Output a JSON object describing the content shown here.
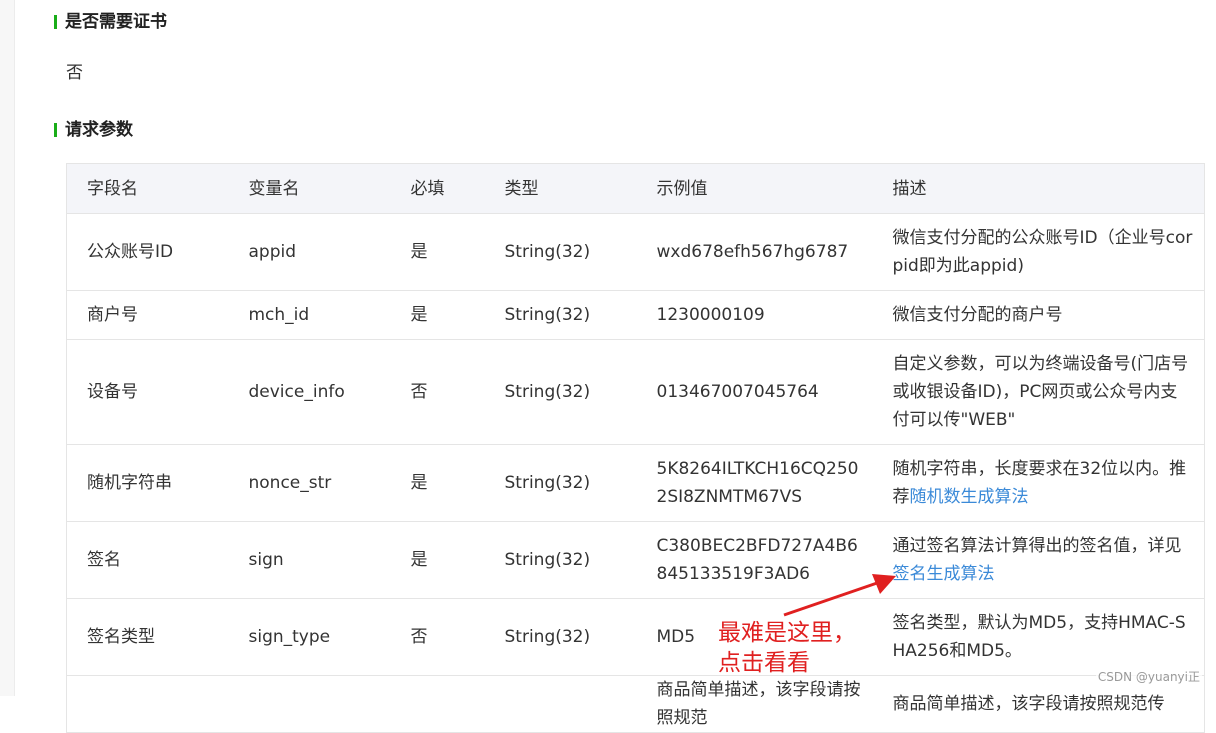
{
  "cert_section": {
    "title": "是否需要证书",
    "value": "否"
  },
  "params_section": {
    "title": "请求参数"
  },
  "table": {
    "headers": [
      "字段名",
      "变量名",
      "必填",
      "类型",
      "示例值",
      "描述"
    ],
    "rows": [
      {
        "field": "公众账号ID",
        "var": "appid",
        "required": "是",
        "type": "String(32)",
        "example": "wxd678efh567hg6787",
        "desc": "微信支付分配的公众账号ID（企业号corpid即为此appid)"
      },
      {
        "field": "商户号",
        "var": "mch_id",
        "required": "是",
        "type": "String(32)",
        "example": "1230000109",
        "desc": "微信支付分配的商户号"
      },
      {
        "field": "设备号",
        "var": "device_info",
        "required": "否",
        "type": "String(32)",
        "example": "013467007045764",
        "desc": "自定义参数，可以为终端设备号(门店号或收银设备ID)，PC网页或公众号内支付可以传\"WEB\""
      },
      {
        "field": "随机字符串",
        "var": "nonce_str",
        "required": "是",
        "type": "String(32)",
        "example": "5K8264ILTKCH16CQ2502SI8ZNMTM67VS",
        "desc_text": "随机字符串，长度要求在32位以内。推荐",
        "desc_link": "随机数生成算法"
      },
      {
        "field": "签名",
        "var": "sign",
        "required": "是",
        "type": "String(32)",
        "example": "C380BEC2BFD727A4B6845133519F3AD6",
        "desc_text": "通过签名算法计算得出的签名值，详见",
        "desc_link": "签名生成算法"
      },
      {
        "field": "签名类型",
        "var": "sign_type",
        "required": "否",
        "type": "String(32)",
        "example": "MD5",
        "desc": "签名类型，默认为MD5，支持HMAC-SHA256和MD5。"
      },
      {
        "field": "",
        "var": "",
        "required": "",
        "type": "",
        "example": "商品简单描述，该字段请按照规范",
        "desc": "商品简单描述，该字段请按照规范传"
      }
    ]
  },
  "annotation": {
    "line1": "最难是这里，",
    "line2": "点击看看",
    "color": "#e02020"
  },
  "watermark": "CSDN @yuanyi正",
  "colors": {
    "accent_green": "#1aad19",
    "link_blue": "#3b8ad8",
    "header_bg": "#f4f5f9"
  }
}
